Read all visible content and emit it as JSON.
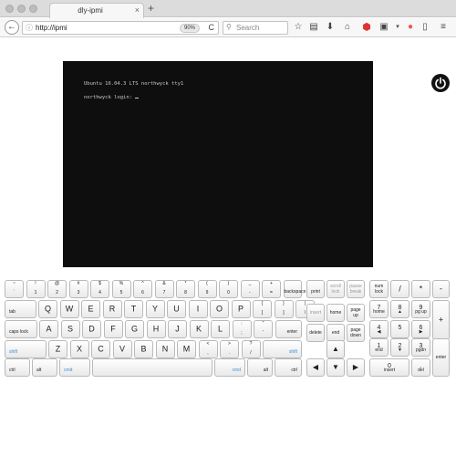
{
  "browser": {
    "tab_title": "dly-ipmi",
    "tab_close": "×",
    "new_tab": "+",
    "back": "←",
    "url": "http://ipmi",
    "zoom": "90%",
    "reload": "C",
    "search_placeholder": "Search",
    "toolbar_icons": [
      "star-icon",
      "reading-list-icon",
      "download-icon",
      "home-icon",
      "adblock-icon",
      "extension-icon",
      "menu-overflow-icon",
      "color-extension-icon",
      "clipboard-icon",
      "hamburger-menu-icon"
    ]
  },
  "console": {
    "line1": "Ubuntu 16.04.3 LTS northwyck tty1",
    "line2": "northwyck login: "
  },
  "power": {
    "icon": "power-icon"
  },
  "keyboard": {
    "row1": [
      {
        "top": "~",
        "bottom": "`"
      },
      {
        "top": "!",
        "bottom": "1"
      },
      {
        "top": "@",
        "bottom": "2"
      },
      {
        "top": "#",
        "bottom": "3"
      },
      {
        "top": "$",
        "bottom": "4"
      },
      {
        "top": "%",
        "bottom": "5"
      },
      {
        "top": "^",
        "bottom": "6"
      },
      {
        "top": "&",
        "bottom": "7"
      },
      {
        "top": "*",
        "bottom": "8"
      },
      {
        "top": "(",
        "bottom": "9"
      },
      {
        "top": ")",
        "bottom": "0"
      },
      {
        "top": "_",
        "bottom": "-"
      },
      {
        "top": "+",
        "bottom": "="
      }
    ],
    "backspace": "backspace",
    "tab": "tab",
    "row2_letters": [
      "Q",
      "W",
      "E",
      "R",
      "T",
      "Y",
      "U",
      "I",
      "O",
      "P"
    ],
    "row2_sym": [
      {
        "top": "{",
        "bottom": "["
      },
      {
        "top": "}",
        "bottom": "]"
      },
      {
        "top": "|",
        "bottom": "\\"
      }
    ],
    "caps": "caps lock",
    "row3_letters": [
      "A",
      "S",
      "D",
      "F",
      "G",
      "H",
      "J",
      "K",
      "L"
    ],
    "row3_sym": [
      {
        "top": ":",
        "bottom": ";"
      },
      {
        "top": "\"",
        "bottom": "'"
      }
    ],
    "enter": "enter",
    "shift_left": "shift",
    "row4_letters": [
      "Z",
      "X",
      "C",
      "V",
      "B",
      "N",
      "M"
    ],
    "row4_sym": [
      {
        "top": "<",
        "bottom": ","
      },
      {
        "top": ">",
        "bottom": "."
      },
      {
        "top": "?",
        "bottom": "/"
      }
    ],
    "shift_right": "shift",
    "ctrl_left": "ctrl",
    "alt_left": "alt",
    "cmd_left": "cmd",
    "cmd_right": "cmd",
    "alt_right": "alt",
    "ctrl_right": "ctrl",
    "print": "print",
    "scroll_lock": "scroll lock",
    "pause_break": "pause break",
    "insert": "insert",
    "home": "home",
    "page_up": "page up",
    "delete": "delete",
    "end": "end",
    "page_down": "page down",
    "arrow_up": "▲",
    "arrow_left": "◀",
    "arrow_down": "▼",
    "arrow_right": "▶",
    "num_lock": "num lock",
    "num_div": "/",
    "num_mul": "*",
    "num_minus": "-",
    "num7": {
      "main": "7",
      "sub": "home"
    },
    "num8": {
      "main": "8",
      "sub": "▲"
    },
    "num9": {
      "main": "9",
      "sub": "pg up"
    },
    "num_plus": "+",
    "num4": {
      "main": "4",
      "sub": "◀"
    },
    "num5": {
      "main": "5",
      "sub": ""
    },
    "num6": {
      "main": "6",
      "sub": "▶"
    },
    "num1": {
      "main": "1",
      "sub": "end"
    },
    "num2": {
      "main": "2",
      "sub": "▼"
    },
    "num3": {
      "main": "3",
      "sub": "pgdn"
    },
    "num_enter": "enter",
    "num0": {
      "main": "0",
      "sub": "insert"
    },
    "num_dot": {
      "main": ".",
      "sub": "del"
    }
  }
}
